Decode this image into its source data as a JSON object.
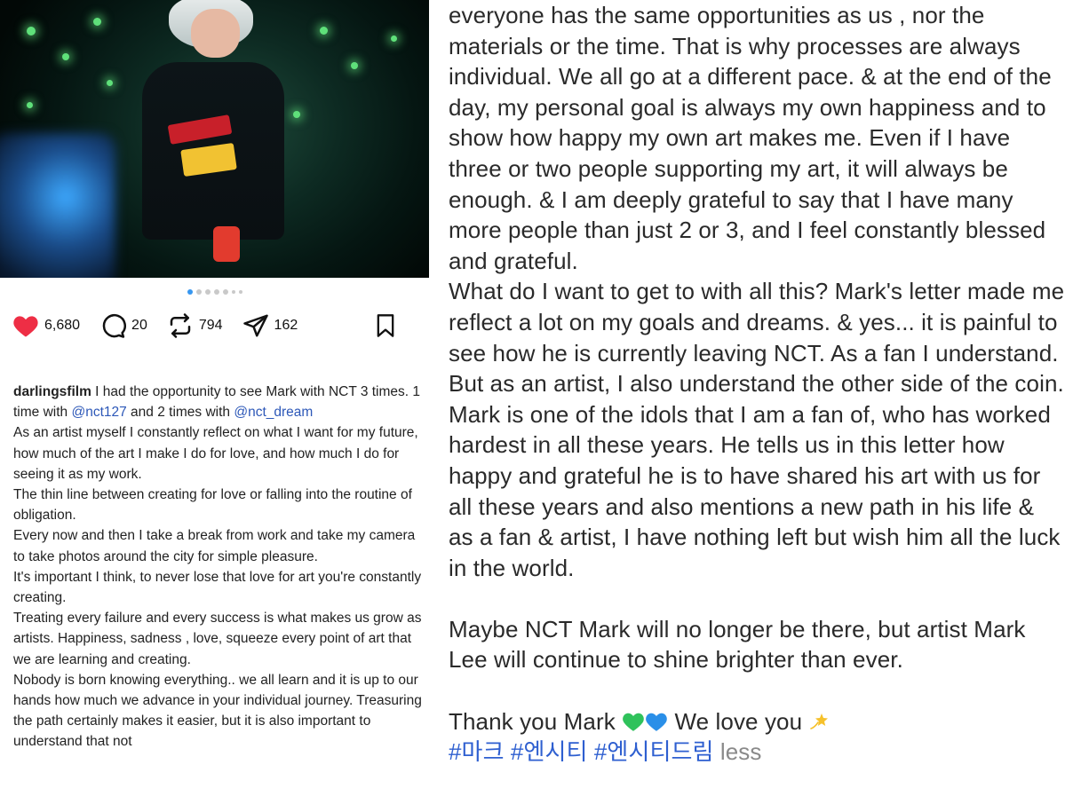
{
  "post": {
    "likes": "6,680",
    "comments": "20",
    "reposts": "794",
    "shares": "162",
    "carousel": {
      "count": 7,
      "active_index": 0
    }
  },
  "caption": {
    "username": "darlingsfilm",
    "line1": " I had the opportunity to see Mark with NCT 3 times. 1 time with ",
    "mention1": "@nct127",
    "line2": " and 2 times with ",
    "mention2": "@nct_dream",
    "body": [
      "As an artist myself I constantly reflect on what I want for my future, how much of the art I make I do for love, and how much I do for seeing it as my work.",
      "The thin line between creating for love or falling into the routine of obligation.",
      "Every now and then I take a break from work and take my camera to take photos around the city for simple pleasure.",
      "It's important I think, to never lose that love for art you're constantly creating.",
      "Treating every failure and every success is what makes us grow as artists. Happiness, sadness , love, squeeze every point of art that we are learning and creating.",
      "Nobody is born knowing everything.. we all learn and it is up to our hands how much we advance in your individual journey. Treasuring the path certainly makes it easier, but it is also important to understand that not"
    ]
  },
  "continued": {
    "para1": "everyone has the same opportunities as us , nor the materials or the time. That is why processes are always individual. We all go at a different pace. & at the end of the day, my personal goal is always my own happiness and to show how happy my own art makes me. Even if I have three or two people supporting my art, it will always be enough. & I am deeply grateful to say that I have many more people than just 2 or 3, and I feel constantly blessed and grateful.",
    "para2": "What do I want to get to with all this? Mark's letter made me reflect a lot on my goals and dreams. & yes... it is painful to see how he is currently leaving NCT. As a fan I understand. But as an artist, I also understand the other side of the coin.",
    "para3": "Mark is one of the idols that I am a fan of, who has worked hardest in all these years. He tells us in this letter how happy and grateful he is to have shared his art with us for all these years and also mentions a new path in his life & as a fan & artist, I have nothing left but wish him all the luck in the world.",
    "para4": "Maybe NCT Mark will no longer be there, but artist Mark Lee will continue to shine brighter than ever.",
    "thanks": "Thank you Mark ",
    "thanks2": " We love you ",
    "hashtags": "#마크 #엔시티 #엔시티드림",
    "less": "less"
  },
  "colors": {
    "like": "#ee2e45",
    "mention": "#2d58b8",
    "hashtag": "#2e5fd0",
    "carousel_active": "#3797f0"
  },
  "icons": [
    "heart-icon",
    "comment-icon",
    "repost-icon",
    "share-icon",
    "bookmark-icon",
    "green-heart-emoji",
    "blue-heart-emoji",
    "dizzy-star-emoji"
  ]
}
